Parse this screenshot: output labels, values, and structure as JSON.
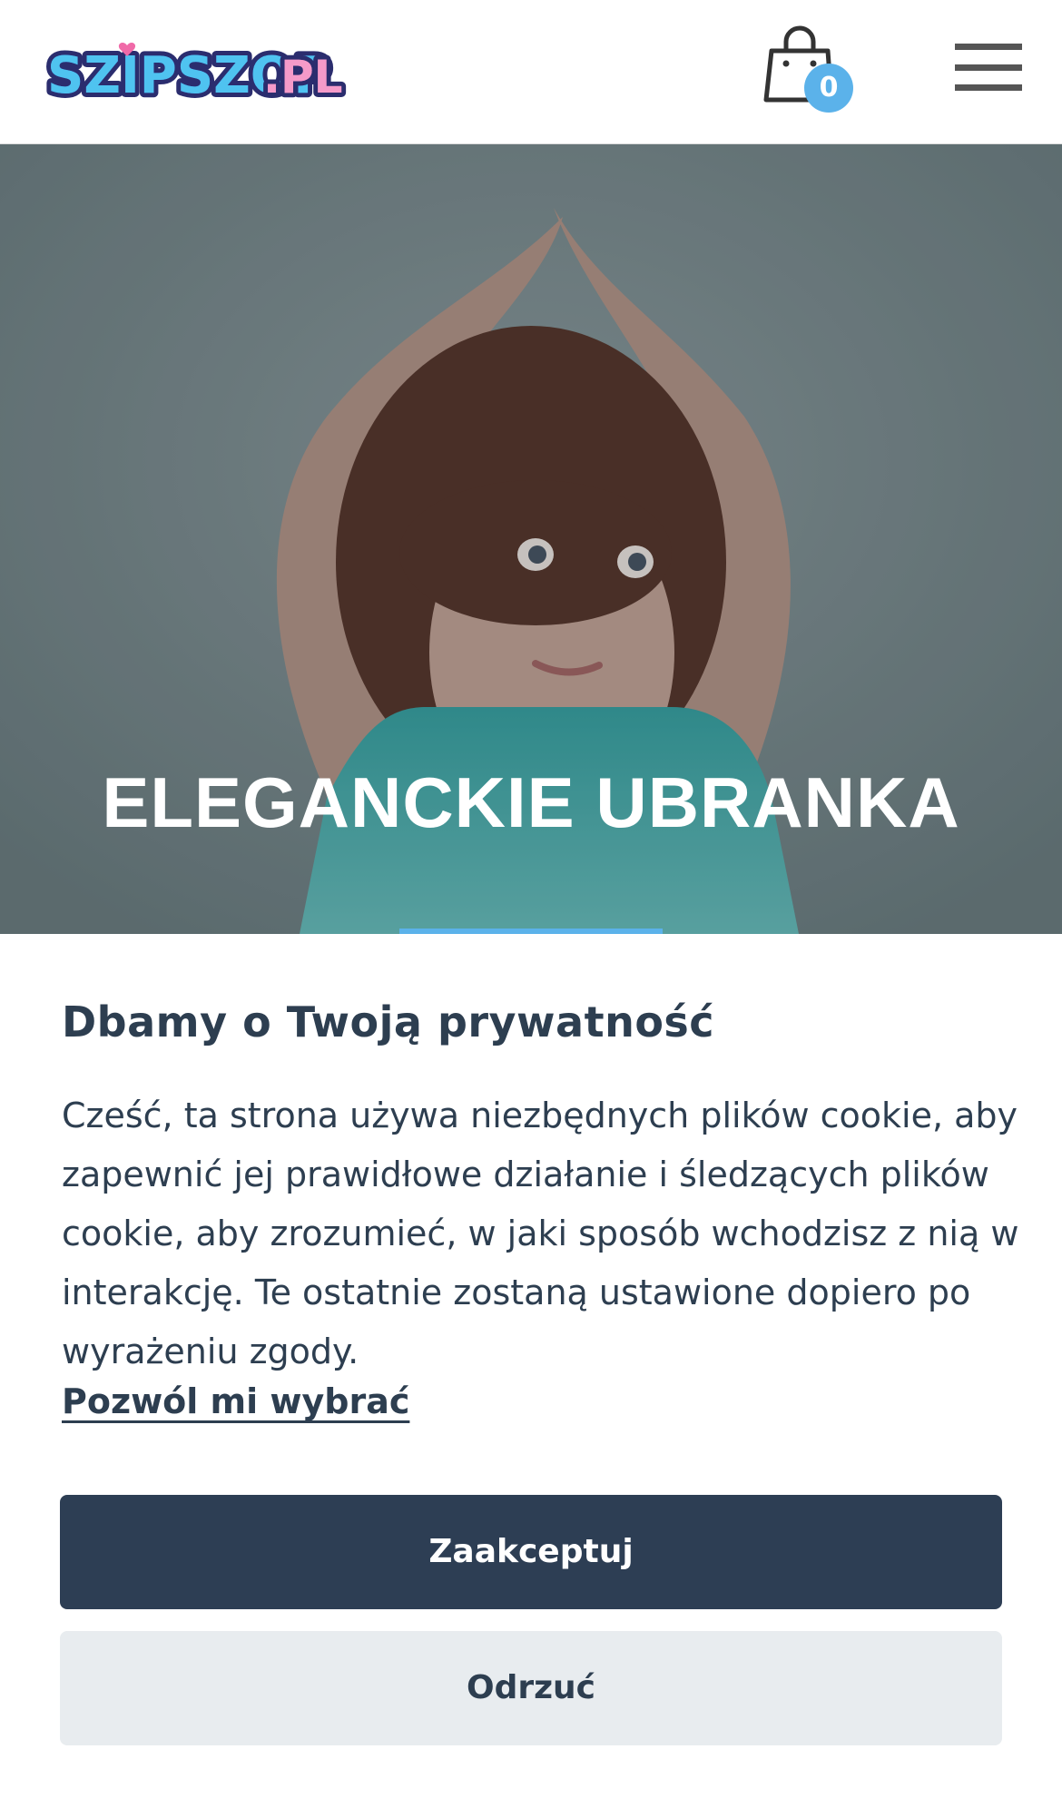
{
  "header": {
    "logo_text": "SZIPSZOP.PL",
    "cart_count": "0"
  },
  "hero": {
    "title": "ELEGANCKIE UBRANKA",
    "slider_active_index": 1
  },
  "consent": {
    "title": "Dbamy o Twoją prywatność",
    "text": "Cześć, ta strona używa niezbędnych plików cookie, aby zapewnić jej prawidłowe działanie i śledzących plików cookie, aby zrozumieć, w jaki sposób wchodzisz z nią w interakcję. Te ostatnie zostaną ustawione dopiero po wyrażeniu zgody.",
    "link_label": "Pozwól mi wybrać",
    "accept_label": "Zaakceptuj",
    "reject_label": "Odrzuć"
  },
  "colors": {
    "accent": "#5bb2ea",
    "primary_button": "#2d3e54",
    "secondary_button": "#e8ecef",
    "text": "#2d3e50"
  },
  "icons": {
    "cart": "shopping-bag-icon",
    "menu": "hamburger-menu-icon"
  }
}
